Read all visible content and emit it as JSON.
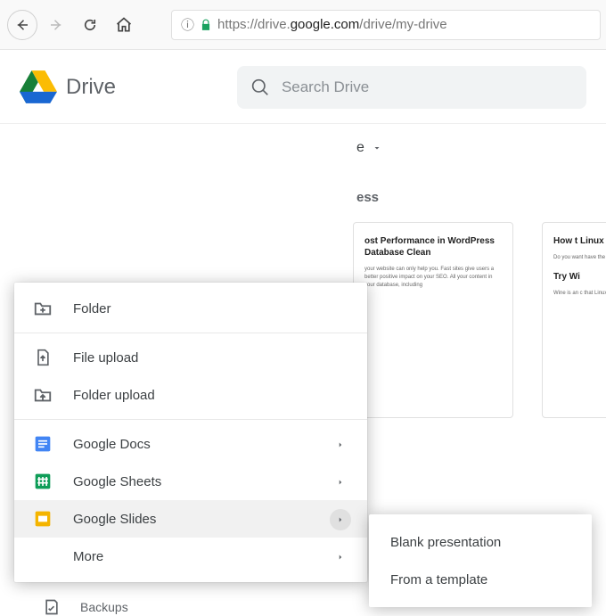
{
  "browser": {
    "url_info_tooltip": "i",
    "url_pre": "https://drive.",
    "url_mid": "google.com",
    "url_post": "/drive/my-drive"
  },
  "header": {
    "app_name": "Drive",
    "search_placeholder": "Search Drive"
  },
  "toolbar": {
    "mydrive_label": "e",
    "section_label": "ess"
  },
  "cards": {
    "a_title": "ost Performance in WordPress Database Clean",
    "a_body": "your website can only help you. Fast sites give users a better positive impact on your SEO. All your content in your database, including",
    "b_title": "How t Linux",
    "b_body": "Do you want have the ter. Below are th",
    "b_sub": "Try Wi",
    "b_sub2": "Wine is an c that Linux u"
  },
  "new_menu": {
    "folder": "Folder",
    "file_upload": "File upload",
    "folder_upload": "Folder upload",
    "docs": "Google Docs",
    "sheets": "Google Sheets",
    "slides": "Google Slides",
    "more": "More"
  },
  "submenu": {
    "blank": "Blank presentation",
    "template": "From a template"
  },
  "sidebar": {
    "backups": "Backups"
  },
  "colors": {
    "docs": "#4285F4",
    "sheets": "#0F9D58",
    "slides": "#F4B400"
  }
}
